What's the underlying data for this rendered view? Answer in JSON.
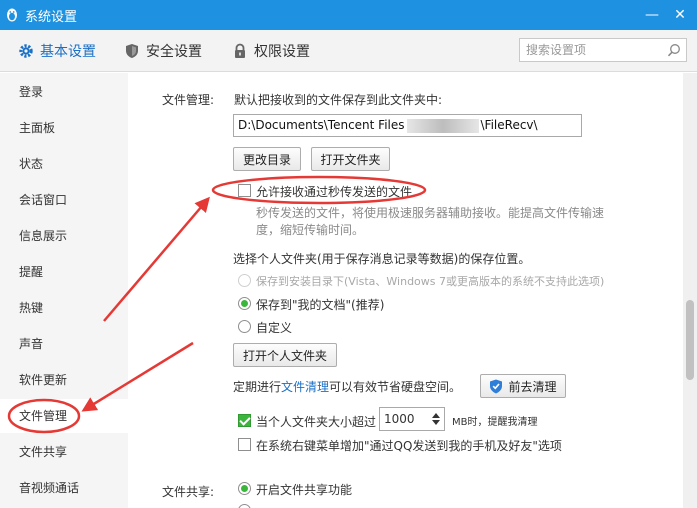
{
  "window": {
    "title": "系统设置",
    "minimize_label": "—",
    "close_label": "✕"
  },
  "tabs": [
    {
      "label": "基本设置",
      "icon": "gear-icon"
    },
    {
      "label": "安全设置",
      "icon": "shield-icon"
    },
    {
      "label": "权限设置",
      "icon": "lock-icon"
    }
  ],
  "search": {
    "placeholder": "搜索设置项",
    "icon": "search-icon"
  },
  "sidebar": {
    "items": [
      {
        "label": "登录"
      },
      {
        "label": "主面板"
      },
      {
        "label": "状态"
      },
      {
        "label": "会话窗口"
      },
      {
        "label": "信息展示"
      },
      {
        "label": "提醒"
      },
      {
        "label": "热键"
      },
      {
        "label": "声音"
      },
      {
        "label": "软件更新"
      },
      {
        "label": "文件管理"
      },
      {
        "label": "文件共享"
      },
      {
        "label": "音视频通话"
      }
    ],
    "active": "文件管理"
  },
  "file_management": {
    "label": "文件管理:",
    "save_path_desc": "默认把接收到的文件保存到此文件夹中:",
    "path_prefix": "D:\\Documents\\Tencent Files",
    "path_suffix": "\\FileRecv\\",
    "change_dir_button": "更改目录",
    "open_folder_button": "打开文件夹",
    "flash_transfer_checkbox": {
      "label": "允许接收通过秒传发送的文件",
      "checked": false
    },
    "flash_transfer_desc_1": "秒传发送的文件，将使用极速服务器辅助接收。能提高文件传输速",
    "flash_transfer_desc_2": "度，缩短传输时间。",
    "personal_folder_desc": "选择个人文件夹(用于保存消息记录等数据)的保存位置。",
    "options": [
      {
        "label": "保存到安装目录下(Vista、Windows 7或更高版本的系统不支持此选项)",
        "checked": false,
        "disabled": true
      },
      {
        "label": "保存到\"我的文档\"(推荐)",
        "checked": true,
        "disabled": false
      },
      {
        "label": "自定义",
        "checked": false,
        "disabled": false
      }
    ],
    "open_personal_folder_button": "打开个人文件夹",
    "cleanup_prefix": "定期进行",
    "cleanup_link": "文件清理",
    "cleanup_suffix": "可以有效节省硬盘空间。",
    "cleanup_button": "前去清理",
    "size_limit_checkbox": {
      "label": "当个人文件夹大小超过",
      "checked": true
    },
    "size_limit_value": "1000",
    "size_limit_unit": "MB时，提醒我清理",
    "context_menu_checkbox": {
      "label": "在系统右键菜单增加\"通过QQ发送到我的手机及好友\"选项",
      "checked": false
    }
  },
  "file_sharing": {
    "label": "文件共享:",
    "enable_radio": {
      "label": "开启文件共享功能",
      "checked": true
    }
  },
  "colors": {
    "titlebar": "#1e92e0",
    "accent": "#1a6fc6",
    "check_green": "#3cb53c",
    "annotation_red": "#e53935"
  }
}
